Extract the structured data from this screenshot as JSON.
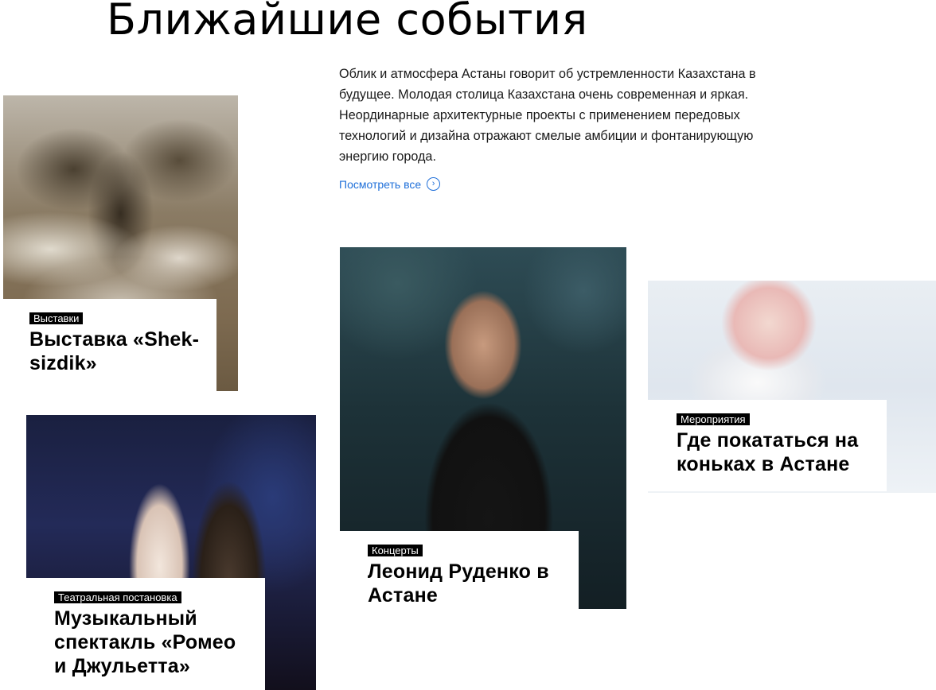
{
  "page": {
    "title": "Ближайшие события",
    "intro": "Облик и атмосфера Астаны говорит об устремленности Казахстана в будущее. Молодая столица Казахстана очень современная и яркая. Неординарные архитектурные проекты с применением передовых технологий и дизайна отражают смелые амбиции и фонтанирующую энергию города.",
    "view_all": "Посмотреть все"
  },
  "events": {
    "exhibition": {
      "tag": "Выставки",
      "title": "Выставка «Shek-sizdik»"
    },
    "concert": {
      "tag": "Концерты",
      "title": "Леонид Руденко в Астане"
    },
    "skating": {
      "tag": "Мероприятия",
      "title": "Где покататься на коньках в Астане"
    },
    "theatre": {
      "tag": "Театральная постановка",
      "title": "Музыкальный спектакль «Ромео и Джульетта»"
    }
  },
  "icons": {
    "view_all_arrow": "chevron-right-circle-icon"
  },
  "colors": {
    "link": "#1e6fd9",
    "tag_bg": "#000000",
    "text": "#000000"
  }
}
